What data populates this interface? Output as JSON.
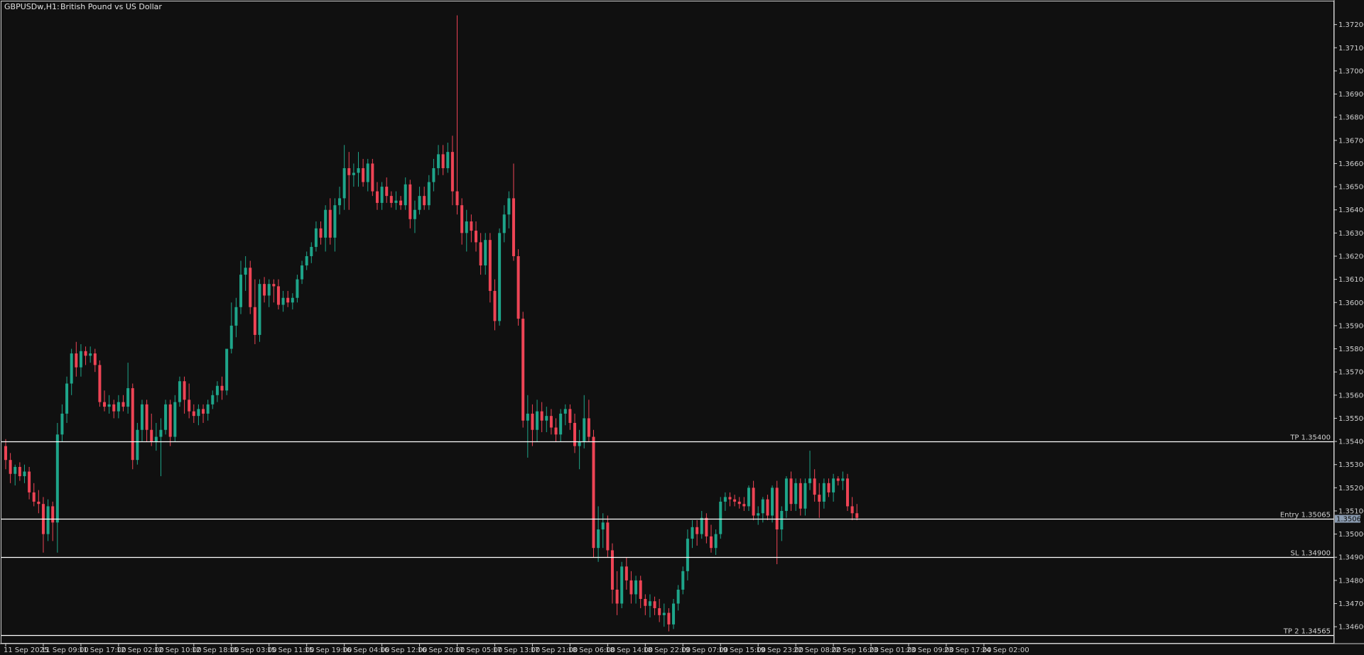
{
  "header": {
    "symbol": "GBPUSDw,H1:",
    "description": "British Pound vs US Dollar"
  },
  "colors": {
    "background": "#101010",
    "bull": "#1ea58a",
    "bear": "#ee4455",
    "wick_bull": "#1ea58a",
    "wick_bear": "#ee4455",
    "axis": "#d0d0d0",
    "level_line": "#ffffff",
    "price_label_bg": "#8a9bb0"
  },
  "current_price": {
    "label": "1.35066",
    "value": 1.35066
  },
  "levels": [
    {
      "label": "TP 1.35400",
      "value": 1.354
    },
    {
      "label": "Entry 1.35065",
      "value": 1.35065
    },
    {
      "label": "SL 1.34900",
      "value": 1.349
    },
    {
      "label": "TP 2 1.34565",
      "value": 1.34565
    }
  ],
  "chart_data": {
    "type": "candlestick",
    "timeframe": "H1",
    "ylim": [
      1.3453,
      1.373
    ],
    "y_ticks": [
      "1.37200",
      "1.37100",
      "1.37000",
      "1.36900",
      "1.36800",
      "1.36700",
      "1.36600",
      "1.36500",
      "1.36400",
      "1.36300",
      "1.36200",
      "1.36100",
      "1.36000",
      "1.35900",
      "1.35800",
      "1.35700",
      "1.35600",
      "1.35500",
      "1.35400",
      "1.35300",
      "1.35200",
      "1.35100",
      "1.35000",
      "1.34900",
      "1.34800",
      "1.34700",
      "1.34600"
    ],
    "x_ticks": [
      {
        "label": "11 Sep 2025",
        "bar": 0
      },
      {
        "label": "11 Sep 09:00",
        "bar": 8
      },
      {
        "label": "11 Sep 17:00",
        "bar": 16
      },
      {
        "label": "12 Sep 02:00",
        "bar": 24
      },
      {
        "label": "12 Sep 10:00",
        "bar": 32
      },
      {
        "label": "12 Sep 18:00",
        "bar": 40
      },
      {
        "label": "15 Sep 03:00",
        "bar": 48
      },
      {
        "label": "15 Sep 11:00",
        "bar": 56
      },
      {
        "label": "15 Sep 19:00",
        "bar": 64
      },
      {
        "label": "16 Sep 04:00",
        "bar": 72
      },
      {
        "label": "16 Sep 12:00",
        "bar": 80
      },
      {
        "label": "16 Sep 20:00",
        "bar": 88
      },
      {
        "label": "17 Sep 05:00",
        "bar": 96
      },
      {
        "label": "17 Sep 13:00",
        "bar": 104
      },
      {
        "label": "17 Sep 21:00",
        "bar": 112
      },
      {
        "label": "18 Sep 06:00",
        "bar": 120
      },
      {
        "label": "18 Sep 14:00",
        "bar": 128
      },
      {
        "label": "18 Sep 22:00",
        "bar": 136
      },
      {
        "label": "19 Sep 07:00",
        "bar": 144
      },
      {
        "label": "19 Sep 15:00",
        "bar": 152
      },
      {
        "label": "19 Sep 23:00",
        "bar": 160
      },
      {
        "label": "22 Sep 08:00",
        "bar": 168
      },
      {
        "label": "22 Sep 16:00",
        "bar": 176
      },
      {
        "label": "23 Sep 01:00",
        "bar": 184
      },
      {
        "label": "23 Sep 09:00",
        "bar": 192
      },
      {
        "label": "23 Sep 17:00",
        "bar": 200
      },
      {
        "label": "24 Sep 02:00",
        "bar": 208
      }
    ],
    "candles": [
      [
        1.3538,
        1.3541,
        1.3528,
        1.3532
      ],
      [
        1.3532,
        1.3535,
        1.3522,
        1.3526
      ],
      [
        1.3526,
        1.353,
        1.3521,
        1.3529
      ],
      [
        1.3529,
        1.3531,
        1.3523,
        1.3525
      ],
      [
        1.3525,
        1.353,
        1.3522,
        1.3527
      ],
      [
        1.3527,
        1.3529,
        1.3515,
        1.3518
      ],
      [
        1.3518,
        1.3522,
        1.3512,
        1.3514
      ],
      [
        1.3514,
        1.3519,
        1.3509,
        1.3513
      ],
      [
        1.3513,
        1.3516,
        1.3492,
        1.35
      ],
      [
        1.35,
        1.3515,
        1.3497,
        1.3512
      ],
      [
        1.3512,
        1.3514,
        1.3497,
        1.3505
      ],
      [
        1.3505,
        1.3548,
        1.3492,
        1.3543
      ],
      [
        1.3543,
        1.3556,
        1.354,
        1.3552
      ],
      [
        1.3552,
        1.3568,
        1.3548,
        1.3565
      ],
      [
        1.3565,
        1.358,
        1.356,
        1.3578
      ],
      [
        1.3578,
        1.3583,
        1.3568,
        1.3572
      ],
      [
        1.3572,
        1.3582,
        1.3568,
        1.3579
      ],
      [
        1.3579,
        1.3581,
        1.3573,
        1.3577
      ],
      [
        1.3577,
        1.3581,
        1.3574,
        1.3578
      ],
      [
        1.3578,
        1.358,
        1.357,
        1.3573
      ],
      [
        1.3573,
        1.3575,
        1.3555,
        1.3557
      ],
      [
        1.3557,
        1.3562,
        1.3553,
        1.3555
      ],
      [
        1.3555,
        1.356,
        1.3552,
        1.3556
      ],
      [
        1.3556,
        1.3558,
        1.355,
        1.3553
      ],
      [
        1.3553,
        1.356,
        1.355,
        1.3557
      ],
      [
        1.3557,
        1.356,
        1.3553,
        1.3555
      ],
      [
        1.3555,
        1.3574,
        1.3552,
        1.3563
      ],
      [
        1.3563,
        1.3565,
        1.3528,
        1.3532
      ],
      [
        1.3532,
        1.3548,
        1.353,
        1.3545
      ],
      [
        1.3545,
        1.3558,
        1.354,
        1.3556
      ],
      [
        1.3556,
        1.3558,
        1.354,
        1.3545
      ],
      [
        1.3545,
        1.3552,
        1.3538,
        1.354
      ],
      [
        1.354,
        1.3548,
        1.3536,
        1.3542
      ],
      [
        1.3542,
        1.355,
        1.3525,
        1.3545
      ],
      [
        1.3545,
        1.3558,
        1.3543,
        1.3556
      ],
      [
        1.3556,
        1.3558,
        1.3538,
        1.3542
      ],
      [
        1.3542,
        1.356,
        1.354,
        1.3557
      ],
      [
        1.3557,
        1.3568,
        1.3555,
        1.3566
      ],
      [
        1.3566,
        1.3568,
        1.3552,
        1.3558
      ],
      [
        1.3558,
        1.3565,
        1.355,
        1.3553
      ],
      [
        1.3553,
        1.3556,
        1.3548,
        1.3551
      ],
      [
        1.3551,
        1.3556,
        1.3547,
        1.3554
      ],
      [
        1.3554,
        1.3556,
        1.3548,
        1.3552
      ],
      [
        1.3552,
        1.3558,
        1.3549,
        1.3556
      ],
      [
        1.3556,
        1.3562,
        1.3554,
        1.356
      ],
      [
        1.356,
        1.3566,
        1.3557,
        1.3564
      ],
      [
        1.3564,
        1.3568,
        1.3558,
        1.3562
      ],
      [
        1.3562,
        1.3575,
        1.356,
        1.358
      ],
      [
        1.358,
        1.36,
        1.3578,
        1.359
      ],
      [
        1.359,
        1.3602,
        1.3585,
        1.3598
      ],
      [
        1.3598,
        1.3618,
        1.3595,
        1.3612
      ],
      [
        1.3612,
        1.362,
        1.3605,
        1.3615
      ],
      [
        1.3615,
        1.3618,
        1.3595,
        1.3598
      ],
      [
        1.3598,
        1.361,
        1.3582,
        1.3586
      ],
      [
        1.3586,
        1.361,
        1.3583,
        1.3608
      ],
      [
        1.3608,
        1.3611,
        1.36,
        1.3603
      ],
      [
        1.3603,
        1.361,
        1.3598,
        1.3608
      ],
      [
        1.3608,
        1.361,
        1.36,
        1.3607
      ],
      [
        1.3607,
        1.361,
        1.3597,
        1.3599
      ],
      [
        1.3599,
        1.3605,
        1.3596,
        1.3602
      ],
      [
        1.3602,
        1.3605,
        1.3598,
        1.36
      ],
      [
        1.36,
        1.3604,
        1.3597,
        1.3602
      ],
      [
        1.3602,
        1.3612,
        1.36,
        1.361
      ],
      [
        1.361,
        1.3618,
        1.3608,
        1.3616
      ],
      [
        1.3616,
        1.3622,
        1.3614,
        1.362
      ],
      [
        1.362,
        1.3626,
        1.3617,
        1.3624
      ],
      [
        1.3624,
        1.3635,
        1.3622,
        1.3632
      ],
      [
        1.3632,
        1.3635,
        1.3625,
        1.3628
      ],
      [
        1.3628,
        1.3642,
        1.3622,
        1.364
      ],
      [
        1.364,
        1.3645,
        1.3625,
        1.3628
      ],
      [
        1.3628,
        1.3645,
        1.3622,
        1.3642
      ],
      [
        1.3642,
        1.365,
        1.3638,
        1.3645
      ],
      [
        1.3645,
        1.3668,
        1.364,
        1.3658
      ],
      [
        1.3658,
        1.3665,
        1.364,
        1.3655
      ],
      [
        1.3655,
        1.366,
        1.365,
        1.3656
      ],
      [
        1.3656,
        1.3665,
        1.365,
        1.3658
      ],
      [
        1.3658,
        1.3662,
        1.365,
        1.3652
      ],
      [
        1.3652,
        1.3662,
        1.3648,
        1.366
      ],
      [
        1.366,
        1.3662,
        1.3646,
        1.3648
      ],
      [
        1.3648,
        1.3652,
        1.364,
        1.3643
      ],
      [
        1.3643,
        1.3652,
        1.364,
        1.365
      ],
      [
        1.365,
        1.3654,
        1.3643,
        1.3646
      ],
      [
        1.3646,
        1.3648,
        1.3641,
        1.3643
      ],
      [
        1.3643,
        1.3648,
        1.364,
        1.3644
      ],
      [
        1.3644,
        1.3646,
        1.364,
        1.3642
      ],
      [
        1.3642,
        1.3654,
        1.364,
        1.3651
      ],
      [
        1.3651,
        1.3653,
        1.3632,
        1.3636
      ],
      [
        1.3636,
        1.3644,
        1.363,
        1.364
      ],
      [
        1.364,
        1.365,
        1.3638,
        1.3646
      ],
      [
        1.3646,
        1.365,
        1.364,
        1.3642
      ],
      [
        1.3642,
        1.3655,
        1.364,
        1.3652
      ],
      [
        1.3652,
        1.3662,
        1.3648,
        1.3658
      ],
      [
        1.3658,
        1.3668,
        1.3655,
        1.3664
      ],
      [
        1.3664,
        1.3668,
        1.3655,
        1.3658
      ],
      [
        1.3658,
        1.3669,
        1.3656,
        1.3665
      ],
      [
        1.3665,
        1.3672,
        1.3642,
        1.3648
      ],
      [
        1.3648,
        1.3724,
        1.3638,
        1.3642
      ],
      [
        1.3642,
        1.3645,
        1.3625,
        1.363
      ],
      [
        1.363,
        1.364,
        1.3622,
        1.3635
      ],
      [
        1.3635,
        1.3638,
        1.3626,
        1.3631
      ],
      [
        1.3631,
        1.3635,
        1.3622,
        1.3626
      ],
      [
        1.3626,
        1.363,
        1.3612,
        1.3616
      ],
      [
        1.3616,
        1.363,
        1.3612,
        1.3627
      ],
      [
        1.3627,
        1.363,
        1.36,
        1.3605
      ],
      [
        1.3605,
        1.361,
        1.3588,
        1.3592
      ],
      [
        1.3592,
        1.3632,
        1.359,
        1.363
      ],
      [
        1.363,
        1.3642,
        1.3626,
        1.3638
      ],
      [
        1.3638,
        1.3648,
        1.3632,
        1.3645
      ],
      [
        1.3645,
        1.366,
        1.3618,
        1.362
      ],
      [
        1.362,
        1.3623,
        1.359,
        1.3593
      ],
      [
        1.3593,
        1.3596,
        1.3546,
        1.3549
      ],
      [
        1.3549,
        1.356,
        1.3533,
        1.3552
      ],
      [
        1.3552,
        1.3556,
        1.3538,
        1.3545
      ],
      [
        1.3545,
        1.3558,
        1.354,
        1.3553
      ],
      [
        1.3553,
        1.3557,
        1.3544,
        1.3549
      ],
      [
        1.3549,
        1.3555,
        1.3544,
        1.3551
      ],
      [
        1.3551,
        1.3554,
        1.3543,
        1.3546
      ],
      [
        1.3546,
        1.355,
        1.354,
        1.3543
      ],
      [
        1.3543,
        1.3554,
        1.354,
        1.3552
      ],
      [
        1.3552,
        1.3556,
        1.3547,
        1.3554
      ],
      [
        1.3554,
        1.3556,
        1.3545,
        1.3548
      ],
      [
        1.3548,
        1.3552,
        1.3535,
        1.3538
      ],
      [
        1.3538,
        1.3545,
        1.3528,
        1.354
      ],
      [
        1.354,
        1.356,
        1.3537,
        1.355
      ],
      [
        1.355,
        1.3558,
        1.354,
        1.3542
      ],
      [
        1.3542,
        1.3545,
        1.349,
        1.3494
      ],
      [
        1.3494,
        1.3512,
        1.3488,
        1.3502
      ],
      [
        1.3502,
        1.3509,
        1.3494,
        1.3505
      ],
      [
        1.3505,
        1.3508,
        1.349,
        1.3493
      ],
      [
        1.3493,
        1.3496,
        1.347,
        1.3476
      ],
      [
        1.3476,
        1.3484,
        1.3465,
        1.347
      ],
      [
        1.347,
        1.3488,
        1.3468,
        1.3486
      ],
      [
        1.3486,
        1.349,
        1.3476,
        1.348
      ],
      [
        1.348,
        1.3484,
        1.347,
        1.3474
      ],
      [
        1.3474,
        1.3482,
        1.347,
        1.348
      ],
      [
        1.348,
        1.3482,
        1.3468,
        1.3472
      ],
      [
        1.3472,
        1.3474,
        1.3465,
        1.3469
      ],
      [
        1.3469,
        1.3474,
        1.3464,
        1.3471
      ],
      [
        1.3471,
        1.3473,
        1.3465,
        1.3468
      ],
      [
        1.3468,
        1.3472,
        1.3462,
        1.3465
      ],
      [
        1.3465,
        1.347,
        1.346,
        1.3466
      ],
      [
        1.3466,
        1.3468,
        1.3458,
        1.3461
      ],
      [
        1.3461,
        1.3472,
        1.3459,
        1.347
      ],
      [
        1.347,
        1.3478,
        1.3467,
        1.3476
      ],
      [
        1.3476,
        1.3486,
        1.3474,
        1.3484
      ],
      [
        1.3484,
        1.3502,
        1.348,
        1.3498
      ],
      [
        1.3498,
        1.3506,
        1.3494,
        1.3503
      ],
      [
        1.3503,
        1.3506,
        1.3495,
        1.35
      ],
      [
        1.35,
        1.351,
        1.3498,
        1.3507
      ],
      [
        1.3507,
        1.3509,
        1.3496,
        1.3499
      ],
      [
        1.3499,
        1.3504,
        1.3492,
        1.3494
      ],
      [
        1.3494,
        1.3502,
        1.3491,
        1.35
      ],
      [
        1.35,
        1.3516,
        1.3498,
        1.3514
      ],
      [
        1.3514,
        1.3518,
        1.351,
        1.3516
      ],
      [
        1.3516,
        1.3518,
        1.3512,
        1.3515
      ],
      [
        1.3515,
        1.3517,
        1.3512,
        1.3514
      ],
      [
        1.3514,
        1.3516,
        1.3511,
        1.3513
      ],
      [
        1.3513,
        1.3516,
        1.351,
        1.3512
      ],
      [
        1.3512,
        1.3521,
        1.351,
        1.352
      ],
      [
        1.352,
        1.3523,
        1.3506,
        1.3508
      ],
      [
        1.3508,
        1.3512,
        1.3504,
        1.3509
      ],
      [
        1.3509,
        1.3516,
        1.3505,
        1.3515
      ],
      [
        1.3515,
        1.3517,
        1.3506,
        1.3508
      ],
      [
        1.3508,
        1.3521,
        1.3505,
        1.352
      ],
      [
        1.352,
        1.3523,
        1.3487,
        1.3502
      ],
      [
        1.3502,
        1.3512,
        1.3497,
        1.351
      ],
      [
        1.351,
        1.3525,
        1.3507,
        1.3524
      ],
      [
        1.3524,
        1.3527,
        1.351,
        1.3513
      ],
      [
        1.3513,
        1.3524,
        1.351,
        1.3522
      ],
      [
        1.3522,
        1.3524,
        1.3508,
        1.3511
      ],
      [
        1.3511,
        1.3524,
        1.3508,
        1.3522
      ],
      [
        1.3522,
        1.3536,
        1.3519,
        1.3524
      ],
      [
        1.3524,
        1.3528,
        1.3514,
        1.3517
      ],
      [
        1.3517,
        1.3522,
        1.3507,
        1.3514
      ],
      [
        1.3514,
        1.3524,
        1.3511,
        1.3522
      ],
      [
        1.3522,
        1.3524,
        1.3516,
        1.3518
      ],
      [
        1.3518,
        1.3526,
        1.3514,
        1.3524
      ],
      [
        1.3524,
        1.3525,
        1.3521,
        1.3523
      ],
      [
        1.3523,
        1.3527,
        1.3519,
        1.3524
      ],
      [
        1.3524,
        1.3526,
        1.351,
        1.3512
      ],
      [
        1.3512,
        1.3516,
        1.3506,
        1.3509
      ],
      [
        1.3509,
        1.3513,
        1.3506,
        1.3507
      ]
    ]
  }
}
